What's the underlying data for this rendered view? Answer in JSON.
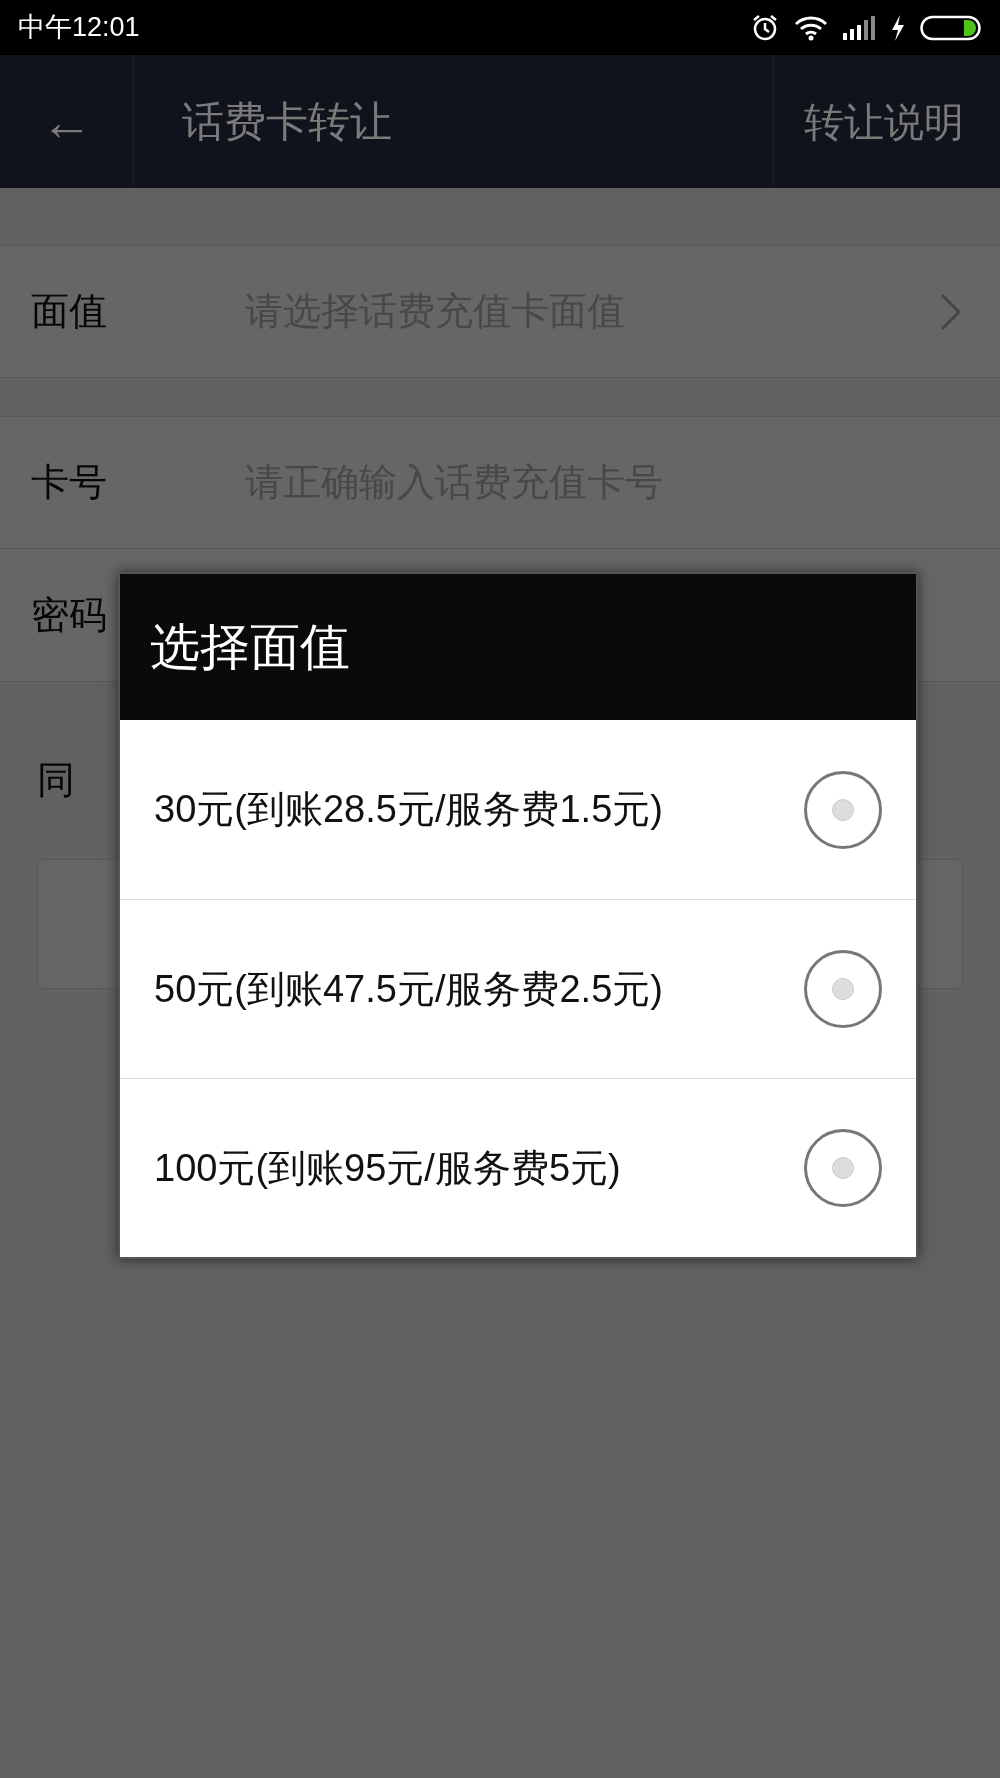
{
  "status_bar": {
    "time": "中午12:01"
  },
  "header": {
    "back": "←",
    "title": "话费卡转让",
    "action": "转让说明"
  },
  "form": {
    "rows": [
      {
        "label": "面值",
        "placeholder": "请选择话费充值卡面值",
        "kind": "select"
      },
      {
        "label": "卡号",
        "placeholder": "请正确输入话费充值卡号",
        "kind": "input"
      },
      {
        "label": "密码",
        "kind": "covered"
      }
    ],
    "agreement": "同"
  },
  "dialog": {
    "title": "选择面值",
    "options": [
      {
        "label": "30元(到账28.5元/服务费1.5元)",
        "selected": false
      },
      {
        "label": "50元(到账47.5元/服务费2.5元)",
        "selected": false
      },
      {
        "label": "100元(到账95元/服务费5元)",
        "selected": false
      }
    ]
  }
}
